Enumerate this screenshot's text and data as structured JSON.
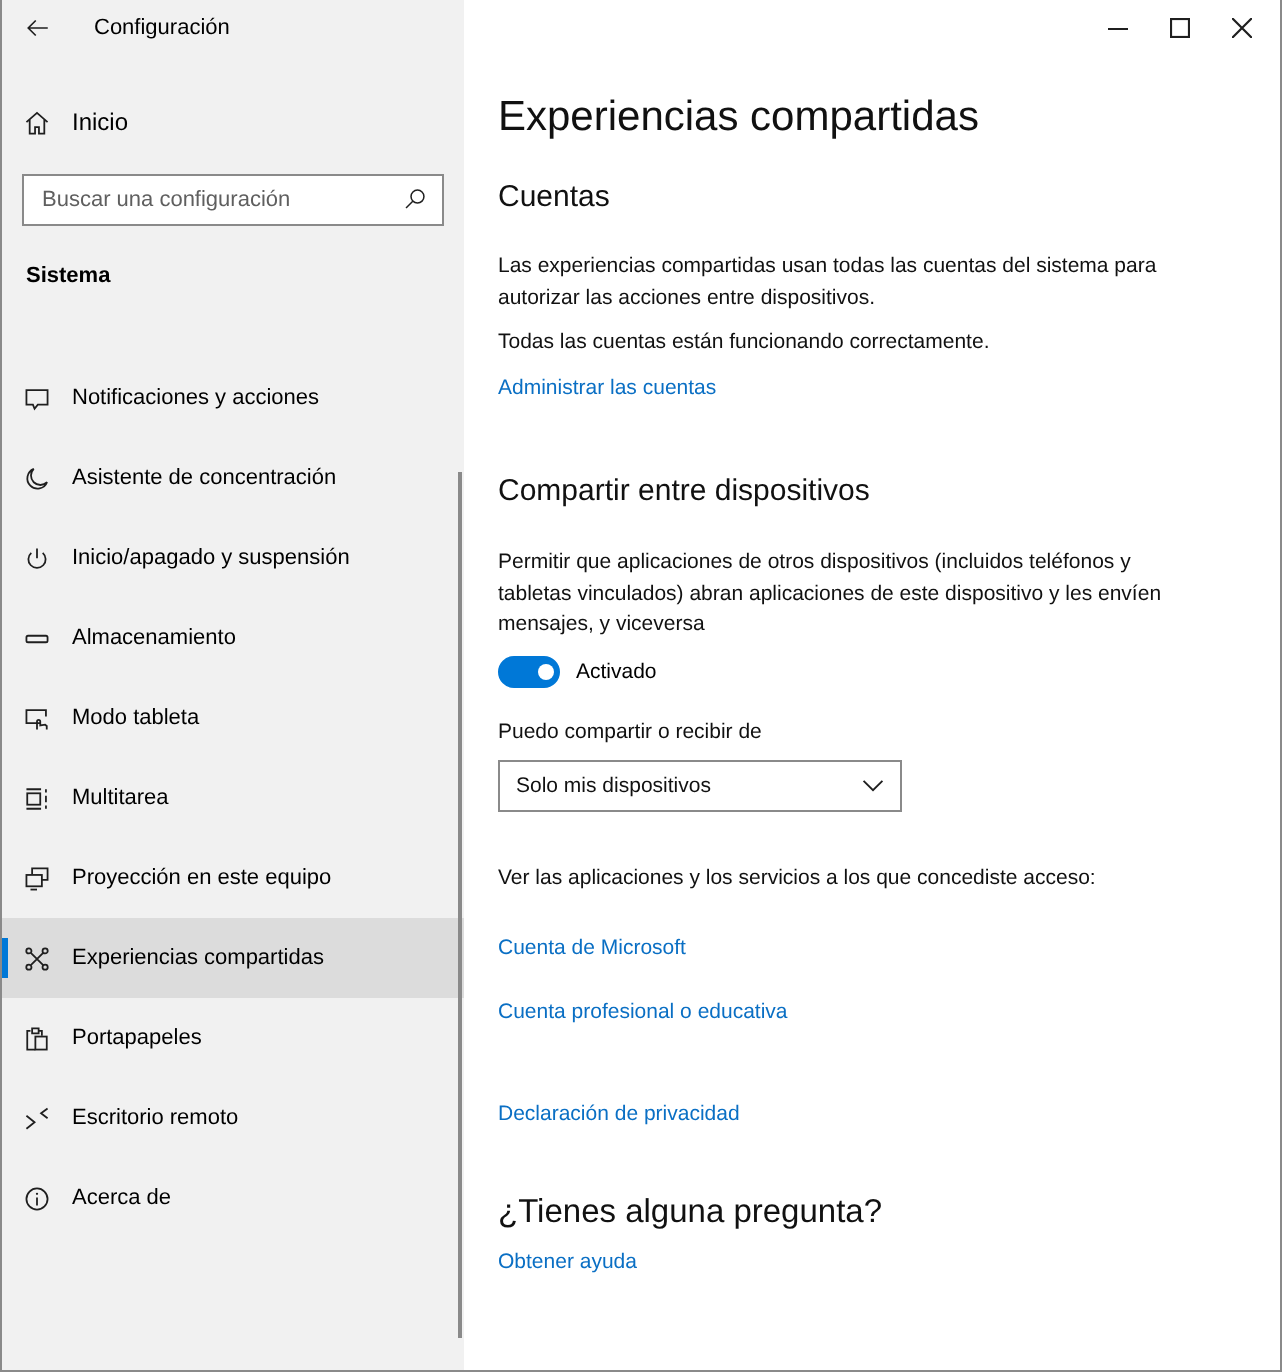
{
  "window": {
    "title": "Configuración"
  },
  "sidebar": {
    "home": "Inicio",
    "search": {
      "placeholder": "Buscar una configuración"
    },
    "section": "Sistema",
    "items": [
      {
        "label": "Notificaciones y acciones",
        "selected": false
      },
      {
        "label": "Asistente de concentración",
        "selected": false
      },
      {
        "label": "Inicio/apagado y suspensión",
        "selected": false
      },
      {
        "label": "Almacenamiento",
        "selected": false
      },
      {
        "label": "Modo tableta",
        "selected": false
      },
      {
        "label": "Multitarea",
        "selected": false
      },
      {
        "label": "Proyección en este equipo",
        "selected": false
      },
      {
        "label": "Experiencias compartidas",
        "selected": true
      },
      {
        "label": "Portapapeles",
        "selected": false
      },
      {
        "label": "Escritorio remoto",
        "selected": false
      },
      {
        "label": "Acerca de",
        "selected": false
      }
    ]
  },
  "page": {
    "title": "Experiencias compartidas",
    "accounts": {
      "heading": "Cuentas",
      "description": "Las experiencias compartidas usan todas las cuentas del sistema para autorizar las acciones entre dispositivos.",
      "status": "Todas las cuentas están funcionando correctamente.",
      "link": "Administrar las cuentas"
    },
    "sharing": {
      "heading": "Compartir entre dispositivos",
      "description": "Permitir que aplicaciones de otros dispositivos (incluidos teléfonos y tabletas vinculados) abran aplicaciones de este dispositivo y les envíen mensajes, y viceversa",
      "toggle": {
        "on": true,
        "label": "Activado"
      },
      "share_label": "Puedo compartir o recibir de",
      "dropdown": {
        "value": "Solo mis dispositivos"
      },
      "access_text": "Ver las aplicaciones y los servicios a los que concediste acceso:",
      "links": [
        "Cuenta de Microsoft",
        "Cuenta profesional o educativa"
      ]
    },
    "privacy_link": "Declaración de privacidad",
    "help": {
      "heading": "¿Tienes alguna pregunta?",
      "link": "Obtener ayuda"
    }
  }
}
